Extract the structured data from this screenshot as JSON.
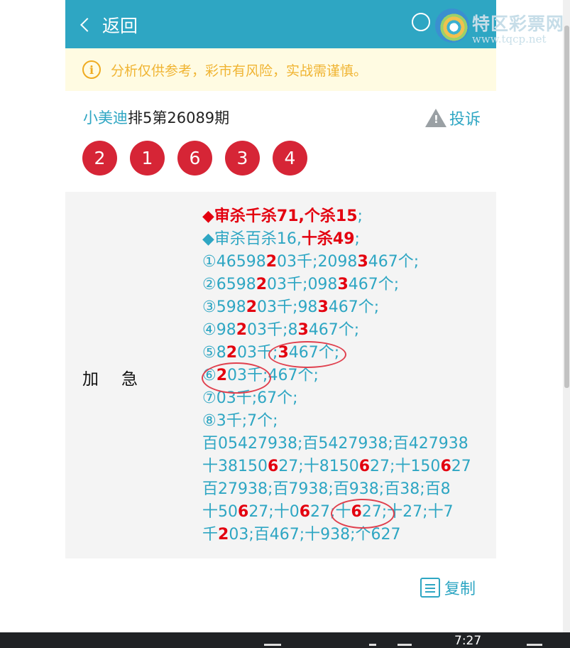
{
  "header": {
    "back_label": "返回",
    "watermark_title": "特区彩票网",
    "watermark_url": "www.tqcp.net"
  },
  "notice": {
    "icon": "i",
    "text": "分析仅供参考，彩市有风险，实战需谨慎。"
  },
  "post": {
    "author": "小美迪",
    "issue": "排5第26089期",
    "report_label": "投诉",
    "balls": [
      "2",
      "1",
      "6",
      "3",
      "4"
    ],
    "label": "加急"
  },
  "lines": [
    [
      {
        "t": "◆审杀千杀71,个杀15",
        "c": "r"
      },
      {
        "t": ";"
      }
    ],
    [
      {
        "t": "◆审杀百杀16,"
      },
      {
        "t": "十杀49",
        "c": "r"
      },
      {
        "t": ";"
      }
    ],
    [
      {
        "t": "①46598"
      },
      {
        "t": "2",
        "c": "r"
      },
      {
        "t": "03千;2098"
      },
      {
        "t": "3",
        "c": "r"
      },
      {
        "t": "467个;"
      }
    ],
    [
      {
        "t": "②6598"
      },
      {
        "t": "2",
        "c": "r"
      },
      {
        "t": "03千;098"
      },
      {
        "t": "3",
        "c": "r"
      },
      {
        "t": "467个;"
      }
    ],
    [
      {
        "t": "③598"
      },
      {
        "t": "2",
        "c": "r"
      },
      {
        "t": "03千;98"
      },
      {
        "t": "3",
        "c": "r"
      },
      {
        "t": "467个;"
      }
    ],
    [
      {
        "t": "④98"
      },
      {
        "t": "2",
        "c": "r"
      },
      {
        "t": "03千;8"
      },
      {
        "t": "3",
        "c": "r"
      },
      {
        "t": "467个;"
      }
    ],
    [
      {
        "t": "⑤8"
      },
      {
        "t": "2",
        "c": "r"
      },
      {
        "t": "03千;"
      },
      {
        "t": "3",
        "c": "r"
      },
      {
        "t": "467个;"
      }
    ],
    [
      {
        "t": "⑥"
      },
      {
        "t": "2",
        "c": "r"
      },
      {
        "t": "03千;467个;"
      }
    ],
    [
      {
        "t": "⑦03千;67个;"
      }
    ],
    [
      {
        "t": "⑧3千;7个;"
      }
    ],
    [
      {
        "t": "百05427938;百5427938;百427938"
      }
    ],
    [
      {
        "t": "十38150"
      },
      {
        "t": "6",
        "c": "r"
      },
      {
        "t": "27;十8150"
      },
      {
        "t": "6",
        "c": "r"
      },
      {
        "t": "27;十150"
      },
      {
        "t": "6",
        "c": "r"
      },
      {
        "t": "27"
      }
    ],
    [
      {
        "t": "百27938;百7938;百938;百38;百8"
      }
    ],
    [
      {
        "t": "十50"
      },
      {
        "t": "6",
        "c": "r"
      },
      {
        "t": "27;十0"
      },
      {
        "t": "6",
        "c": "r"
      },
      {
        "t": "27;十"
      },
      {
        "t": "6",
        "c": "r"
      },
      {
        "t": "27;十27;十7"
      }
    ],
    [
      {
        "t": "千"
      },
      {
        "t": "2",
        "c": "r"
      },
      {
        "t": "03;百467;十938;个627"
      }
    ]
  ],
  "copy_label": "复制",
  "taskbar": {
    "time": "7:27"
  },
  "colors": {
    "accent": "#2ea6c3",
    "ball": "#d62536",
    "highlight": "#e3000f",
    "notice_text": "#f0b432"
  }
}
